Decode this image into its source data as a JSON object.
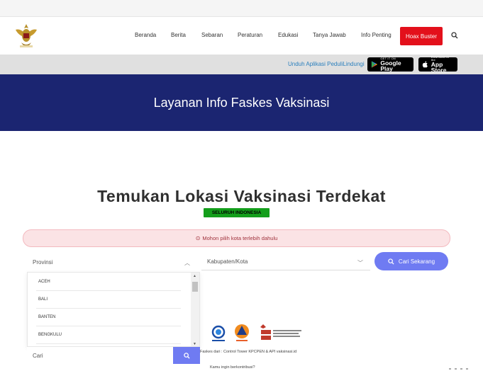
{
  "nav": {
    "items": [
      "Beranda",
      "Berita",
      "Sebaran",
      "Peraturan",
      "Edukasi",
      "Tanya Jawab",
      "Info Penting"
    ],
    "hoax_label": "Hoax Buster"
  },
  "appbar": {
    "unduh_text": "Unduh Aplikasi PeduliLindungi",
    "google_small": "GET IT ON",
    "google_big": "Google Play",
    "apple_small": "Download on the",
    "apple_big": "App Store"
  },
  "hero": {
    "title": "Layanan Info Faskes Vaksinasi"
  },
  "main": {
    "title": "Temukan Lokasi Vaksinasi Terdekat",
    "badge": "SELURUH INDONESIA",
    "alert": "Mohon pilih kota terlebih dahulu"
  },
  "form": {
    "provinsi_placeholder": "Provinsi",
    "kabupaten_placeholder": "Kabupaten/Kota",
    "search_button": "Cari Sekarang",
    "dropdown_search_placeholder": "Cari",
    "provinces": [
      "ACEH",
      "BALI",
      "BANTEN",
      "BENGKULU"
    ]
  },
  "footer": {
    "source_text": "Faskes dari : Control Tower KPCPEN & API vaksinasi.id",
    "question": "Kamu ingin berkontribusi?",
    "logo_labels": [
      "KOMINFO",
      "BNPB",
      "KPC PEN"
    ]
  },
  "colors": {
    "hero_bg": "#1b2571",
    "hoax_bg": "#e3101b",
    "badge_bg": "#139e1b",
    "button_bg": "#6f7bf2",
    "alert_bg": "#fbe3e5"
  }
}
